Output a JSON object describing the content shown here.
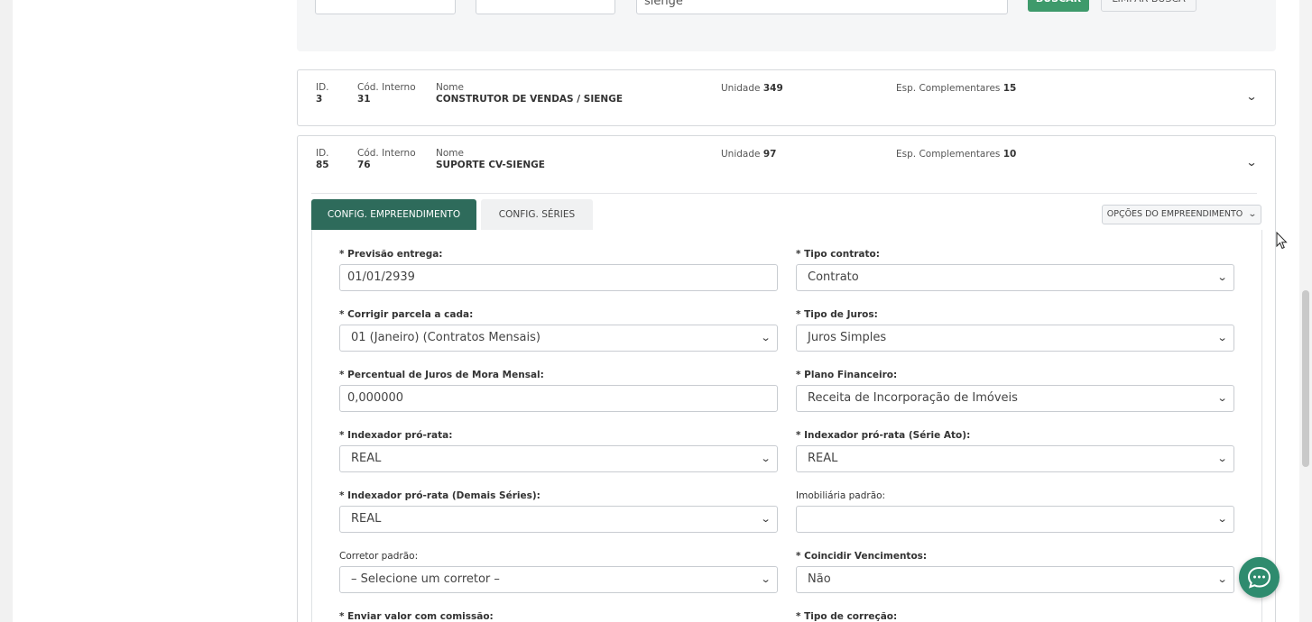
{
  "search": {
    "term": "sienge",
    "buscar_label": "BUSCAR",
    "limpar_label": "LIMPAR BUSCA"
  },
  "labels": {
    "id": "ID.",
    "cod_interno": "Cód. Interno",
    "nome": "Nome",
    "unidade": "Unidade",
    "esp_complementares": "Esp. Complementares"
  },
  "rows": [
    {
      "id": "3",
      "cod_interno": "31",
      "nome": "CONSTRUTOR DE VENDAS / SIENGE",
      "unidade": "349",
      "esp": "15"
    },
    {
      "id": "85",
      "cod_interno": "76",
      "nome": "SUPORTE CV-SIENGE",
      "unidade": "97",
      "esp": "10"
    }
  ],
  "tabs": {
    "active": "CONFIG. EMPREENDIMENTO",
    "inactive": "CONFIG. SÉRIES",
    "options_label": "OPÇÕES DO EMPREENDIMENTO"
  },
  "form": {
    "previsao_entrega": {
      "label": "* Previsão entrega:",
      "value": "01/01/2939"
    },
    "tipo_contrato": {
      "label": "* Tipo contrato:",
      "value": "Contrato"
    },
    "corrigir_parcela": {
      "label": "* Corrigir parcela a cada:",
      "value": "01 (Janeiro) (Contratos Mensais)"
    },
    "tipo_juros": {
      "label": "* Tipo de Juros:",
      "value": "Juros Simples"
    },
    "percentual_juros": {
      "label": "* Percentual de Juros de Mora Mensal:",
      "value": "0,000000"
    },
    "plano_financeiro": {
      "label": "* Plano Financeiro:",
      "value": "Receita de Incorporação de Imóveis"
    },
    "indexador_pro_rata": {
      "label": "* Indexador pró-rata:",
      "value": "REAL"
    },
    "indexador_serie_ato": {
      "label": "* Indexador pró-rata (Série Ato):",
      "value": "REAL"
    },
    "indexador_demais": {
      "label": "* Indexador pró-rata (Demais Séries):",
      "value": "REAL"
    },
    "imobiliaria_padrao": {
      "label": "Imobiliária padrão:",
      "value": ""
    },
    "corretor_padrao": {
      "label": "Corretor padrão:",
      "value": "– Selecione um corretor –"
    },
    "coincidir_vencimentos": {
      "label": "* Coincidir Vencimentos:",
      "value": "Não"
    },
    "enviar_valor_comissao": {
      "label": "* Enviar valor com comissão:"
    },
    "tipo_correcao": {
      "label": "* Tipo de correção:"
    }
  },
  "icons": {
    "chevron": "chevron-down-icon",
    "chat": "chat-icon",
    "cursor": "mouse-cursor-icon"
  },
  "colors": {
    "primary_green": "#3e9a6b",
    "tab_active": "#2e6b5b",
    "chat_button": "#2e8b6e"
  }
}
